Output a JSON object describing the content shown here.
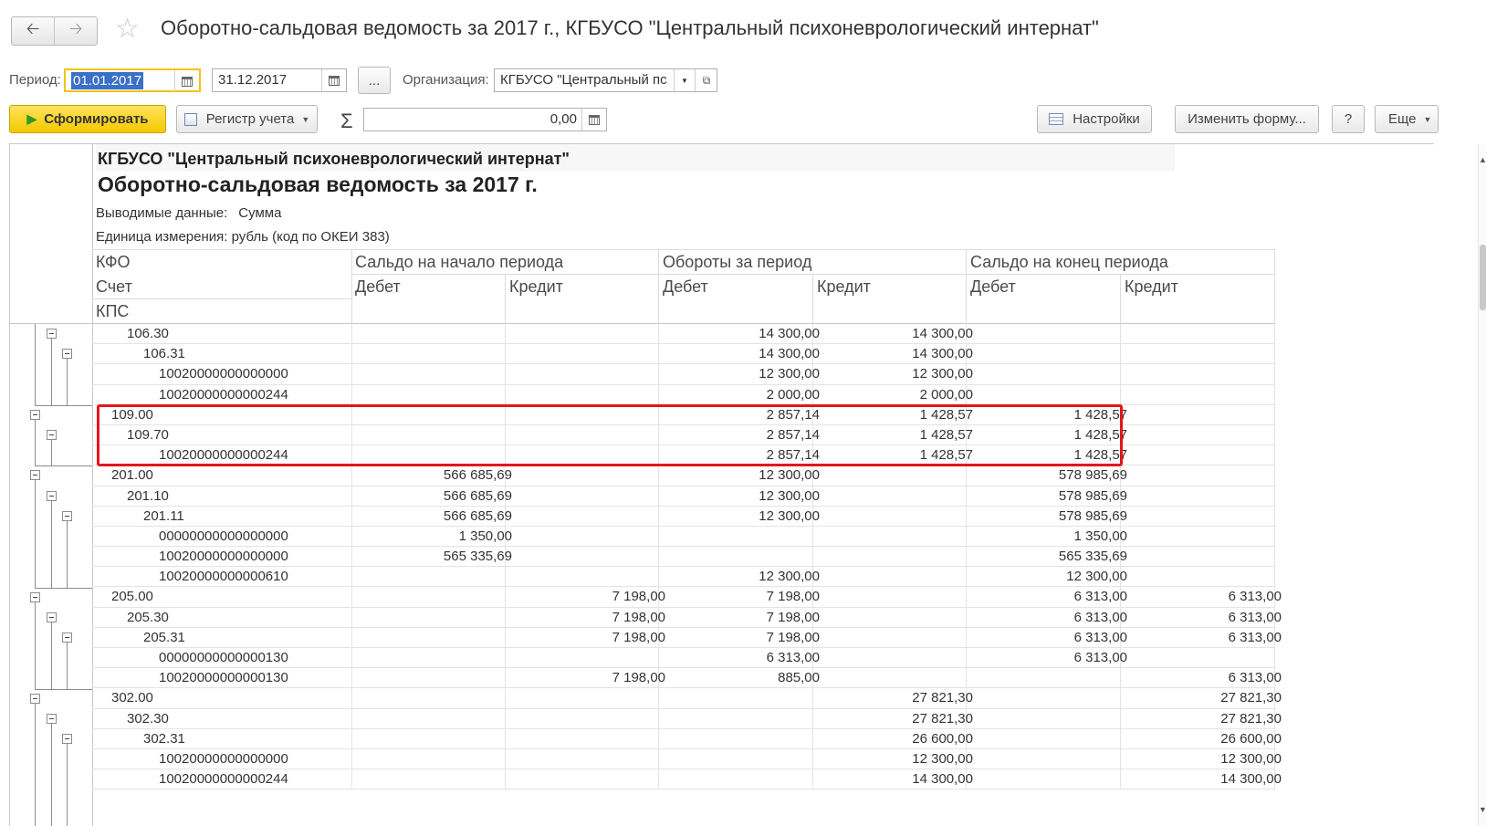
{
  "window": {
    "title": "Оборотно-сальдовая ведомость за 2017 г., КГБУСО \"Центральный психоневрологический интернат\""
  },
  "filters": {
    "period_label": "Период:",
    "date_from": "01.01.2017",
    "date_to": "31.12.2017",
    "ellipsis": "...",
    "org_label": "Организация:",
    "org_value": "КГБУСО \"Центральный пс"
  },
  "toolbar": {
    "generate": "Сформировать",
    "register": "Регистр учета",
    "sum_value": "0,00",
    "settings": "Настройки",
    "change_form": "Изменить форму...",
    "help": "?",
    "more": "Еще"
  },
  "report": {
    "org": "КГБУСО \"Центральный психоневрологический интернат\"",
    "title": "Оборотно-сальдовая ведомость за 2017 г.",
    "data_label": "Выводимые данные:",
    "data_value": "Сумма",
    "unit": "Единица измерения: рубль (код по ОКЕИ 383)",
    "headers": {
      "kfo": "КФО",
      "account": "Счет",
      "kps": "КПС",
      "opening": "Сальдо на начало периода",
      "turnover": "Обороты за период",
      "closing": "Сальдо на конец периода",
      "debit": "Дебет",
      "credit": "Кредит"
    },
    "rows": [
      {
        "name": "106.30",
        "level": 1,
        "v": [
          "",
          "",
          "14 300,00",
          "14 300,00",
          "",
          ""
        ]
      },
      {
        "name": "106.31",
        "level": 2,
        "v": [
          "",
          "",
          "14 300,00",
          "14 300,00",
          "",
          ""
        ]
      },
      {
        "name": "10020000000000000",
        "level": 3,
        "v": [
          "",
          "",
          "12 300,00",
          "12 300,00",
          "",
          ""
        ]
      },
      {
        "name": "10020000000000244",
        "level": 3,
        "v": [
          "",
          "",
          "2 000,00",
          "2 000,00",
          "",
          ""
        ]
      },
      {
        "name": "109.00",
        "level": 0,
        "v": [
          "",
          "",
          "2 857,14",
          "1 428,57",
          "1 428,57",
          ""
        ]
      },
      {
        "name": "109.70",
        "level": 1,
        "v": [
          "",
          "",
          "2 857,14",
          "1 428,57",
          "1 428,57",
          ""
        ]
      },
      {
        "name": "10020000000000244",
        "level": 3,
        "v": [
          "",
          "",
          "2 857,14",
          "1 428,57",
          "1 428,57",
          ""
        ]
      },
      {
        "name": "201.00",
        "level": 0,
        "v": [
          "566 685,69",
          "",
          "12 300,00",
          "",
          "578 985,69",
          ""
        ]
      },
      {
        "name": "201.10",
        "level": 1,
        "v": [
          "566 685,69",
          "",
          "12 300,00",
          "",
          "578 985,69",
          ""
        ]
      },
      {
        "name": "201.11",
        "level": 2,
        "v": [
          "566 685,69",
          "",
          "12 300,00",
          "",
          "578 985,69",
          ""
        ]
      },
      {
        "name": "00000000000000000",
        "level": 3,
        "v": [
          "1 350,00",
          "",
          "",
          "",
          "1 350,00",
          ""
        ]
      },
      {
        "name": "10020000000000000",
        "level": 3,
        "v": [
          "565 335,69",
          "",
          "",
          "",
          "565 335,69",
          ""
        ]
      },
      {
        "name": "10020000000000610",
        "level": 3,
        "v": [
          "",
          "",
          "12 300,00",
          "",
          "12 300,00",
          ""
        ]
      },
      {
        "name": "205.00",
        "level": 0,
        "v": [
          "",
          "7 198,00",
          "7 198,00",
          "",
          "6 313,00",
          "6 313,00"
        ]
      },
      {
        "name": "205.30",
        "level": 1,
        "v": [
          "",
          "7 198,00",
          "7 198,00",
          "",
          "6 313,00",
          "6 313,00"
        ]
      },
      {
        "name": "205.31",
        "level": 2,
        "v": [
          "",
          "7 198,00",
          "7 198,00",
          "",
          "6 313,00",
          "6 313,00"
        ]
      },
      {
        "name": "00000000000000130",
        "level": 3,
        "v": [
          "",
          "",
          "6 313,00",
          "",
          "6 313,00",
          ""
        ]
      },
      {
        "name": "10020000000000130",
        "level": 3,
        "v": [
          "",
          "7 198,00",
          "885,00",
          "",
          "",
          "6 313,00"
        ]
      },
      {
        "name": "302.00",
        "level": 0,
        "v": [
          "",
          "",
          "",
          "27 821,30",
          "",
          "27 821,30"
        ]
      },
      {
        "name": "302.30",
        "level": 1,
        "v": [
          "",
          "",
          "",
          "27 821,30",
          "",
          "27 821,30"
        ]
      },
      {
        "name": "302.31",
        "level": 2,
        "v": [
          "",
          "",
          "",
          "26 600,00",
          "",
          "26 600,00"
        ]
      },
      {
        "name": "10020000000000000",
        "level": 3,
        "v": [
          "",
          "",
          "",
          "12 300,00",
          "",
          "12 300,00"
        ]
      },
      {
        "name": "10020000000000244",
        "level": 3,
        "v": [
          "",
          "",
          "",
          "14 300,00",
          "",
          "14 300,00"
        ]
      }
    ]
  },
  "icons": {
    "back": "arrow-left",
    "forward": "arrow-right",
    "favorite": "star-outline",
    "calendar": "calendar",
    "dropdown": "triangle-down",
    "open": "open-window",
    "sum": "sigma",
    "settings": "settings-list"
  },
  "colors": {
    "primary_button": "#f4c800",
    "highlight_frame": "#e6141a",
    "selection": "#3b70c8"
  }
}
